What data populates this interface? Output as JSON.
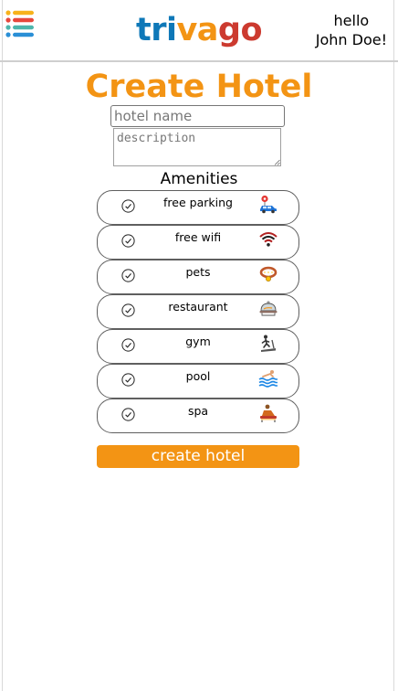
{
  "header": {
    "logo": {
      "part1": "tri",
      "part2": "va",
      "part3": "go"
    },
    "greeting_line1": "hello",
    "greeting_line2": "John Doe!",
    "menu_icon": "list-icon"
  },
  "main": {
    "title": "Create Hotel",
    "hotel_name_placeholder": "hotel name",
    "hotel_name_value": "",
    "description_placeholder": "description",
    "description_value": "",
    "amenities_title": "Amenities",
    "amenities": [
      {
        "label": "free parking",
        "icon": "car-parking-icon",
        "checked": false
      },
      {
        "label": "free wifi",
        "icon": "wifi-icon",
        "checked": false
      },
      {
        "label": "pets",
        "icon": "pet-collar-icon",
        "checked": false
      },
      {
        "label": "restaurant",
        "icon": "food-cloche-icon",
        "checked": false
      },
      {
        "label": "gym",
        "icon": "treadmill-icon",
        "checked": false
      },
      {
        "label": "pool",
        "icon": "swimming-pool-icon",
        "checked": false
      },
      {
        "label": "spa",
        "icon": "massage-icon",
        "checked": false
      }
    ],
    "submit_label": "create hotel"
  },
  "colors": {
    "brand_orange": "#f39414",
    "logo_blue": "#0e78b8",
    "logo_red": "#cc3a2f"
  }
}
